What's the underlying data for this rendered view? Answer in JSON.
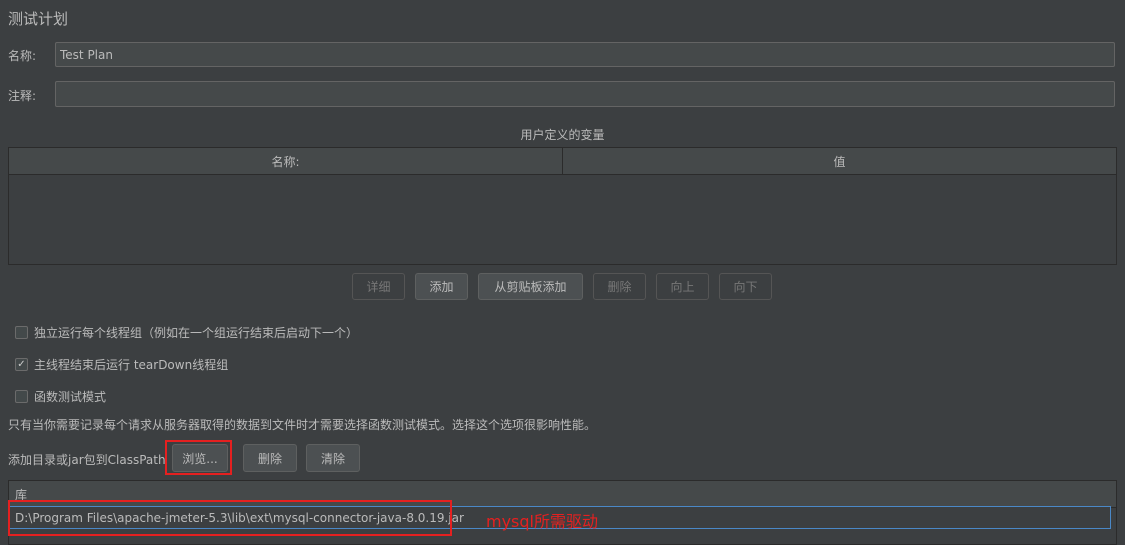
{
  "page": {
    "title": "测试计划"
  },
  "name_field": {
    "label": "名称:",
    "value": "Test Plan"
  },
  "comment_field": {
    "label": "注释:",
    "value": ""
  },
  "variables": {
    "section_title": "用户定义的变量",
    "columns": [
      "名称:",
      "值"
    ],
    "rows": [],
    "buttons": {
      "detail": "详细",
      "add": "添加",
      "add_from_clipboard": "从剪贴板添加",
      "delete": "删除",
      "up": "向上",
      "down": "向下"
    }
  },
  "options": {
    "run_thread_groups_consecutively": {
      "label": "独立运行每个线程组（例如在一个组运行结束后启动下一个）",
      "checked": false
    },
    "run_teardown_after_shutdown": {
      "label": "主线程结束后运行 tearDown线程组",
      "checked": true
    },
    "functional_test_mode": {
      "label": "函数测试模式",
      "checked": false
    },
    "functional_mode_hint": "只有当你需要记录每个请求从服务器取得的数据到文件时才需要选择函数测试模式。选择这个选项很影响性能。"
  },
  "classpath": {
    "label": "添加目录或jar包到ClassPath",
    "buttons": {
      "browse": "浏览...",
      "delete": "删除",
      "clear": "清除"
    },
    "library_header": "库",
    "entries": [
      "D:\\Program Files\\apache-jmeter-5.3\\lib\\ext\\mysql-connector-java-8.0.19.jar"
    ]
  },
  "annotation": {
    "text": "mysql所需驱动",
    "color": "#e52020"
  },
  "theme": {
    "background": "#3c3f41",
    "text": "#bbbbbb",
    "selection_border": "#4a88c7"
  }
}
